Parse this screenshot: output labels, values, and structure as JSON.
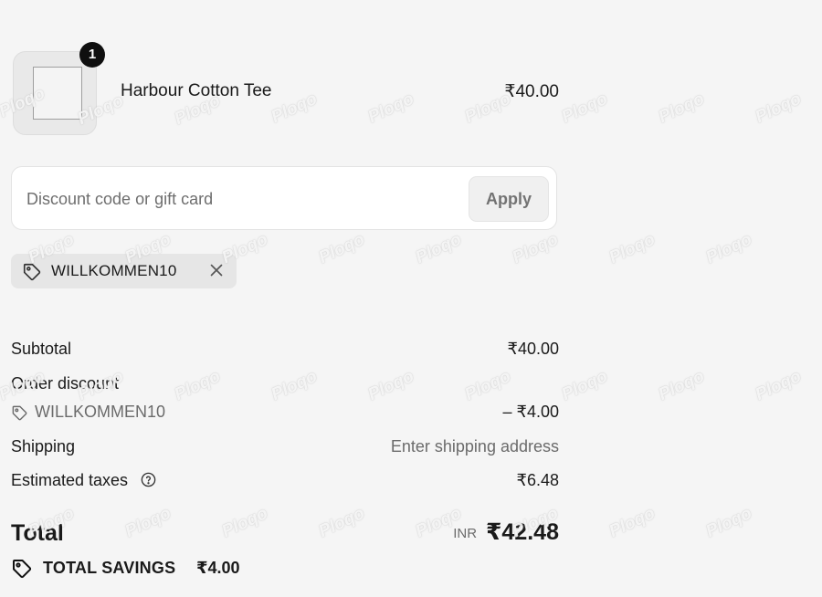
{
  "cart_item": {
    "name": "Harbour Cotton Tee",
    "price": "₹40.00",
    "quantity": "1"
  },
  "discount": {
    "placeholder": "Discount code or gift card",
    "value": "",
    "apply_label": "Apply"
  },
  "applied_code": {
    "code": "WILLKOMMEN10"
  },
  "summary": {
    "subtotal_label": "Subtotal",
    "subtotal_value": "₹40.00",
    "order_discount_label": "Order discount",
    "discount_code": "WILLKOMMEN10",
    "discount_value": "– ₹4.00",
    "shipping_label": "Shipping",
    "shipping_value": "Enter shipping address",
    "taxes_label": "Estimated taxes",
    "taxes_value": "₹6.48",
    "total_label": "Total",
    "currency": "INR",
    "total_value": "₹42.48",
    "savings_label": "TOTAL SAVINGS",
    "savings_value": "₹4.00"
  },
  "icons": {
    "tag": "tag-icon",
    "remove": "close-icon",
    "help": "question-circle-icon"
  },
  "watermark": "Ploqo"
}
